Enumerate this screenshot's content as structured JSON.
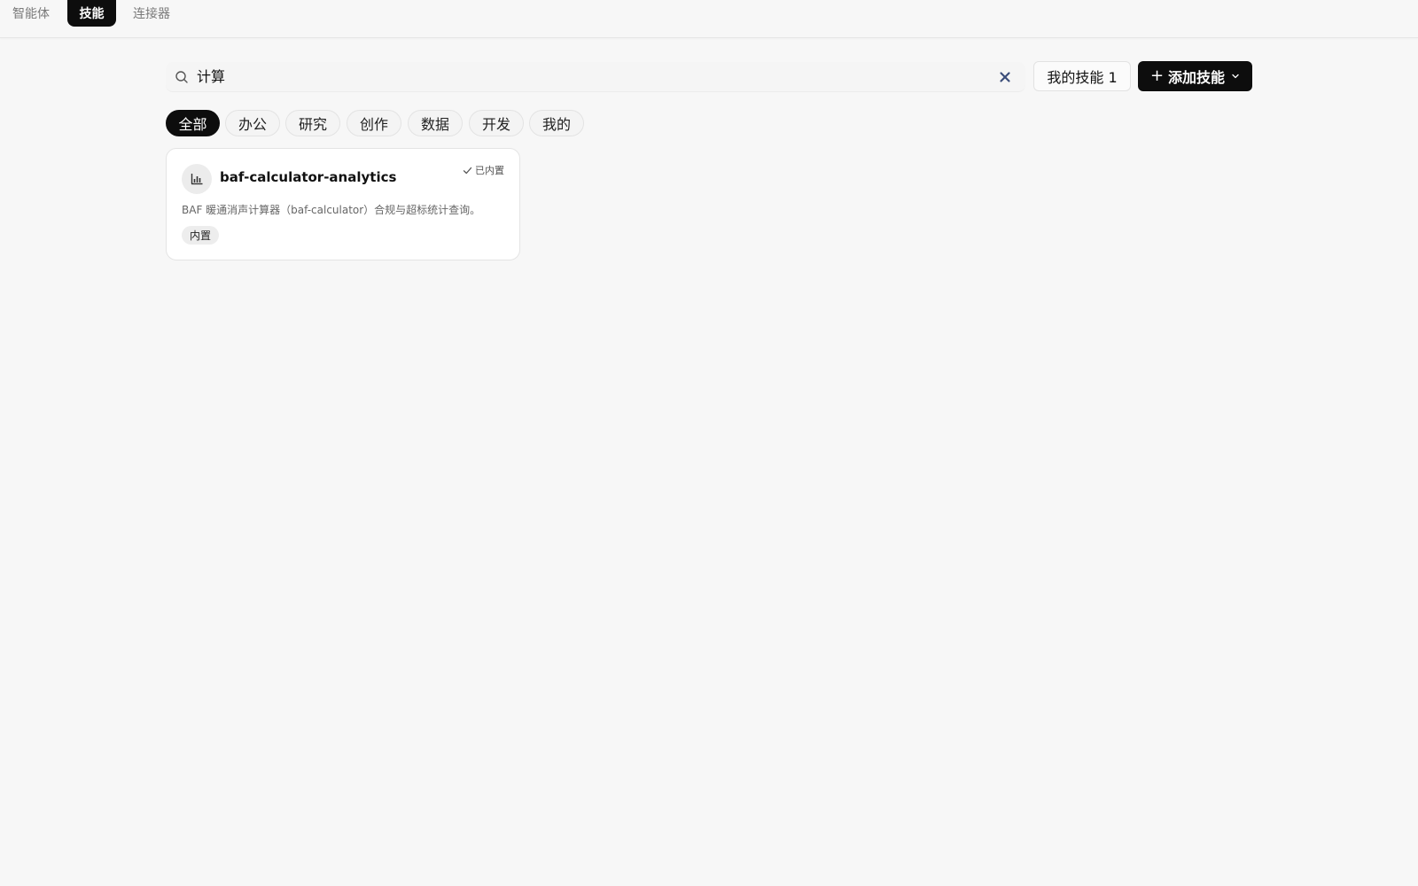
{
  "top_tabs": [
    {
      "label": "智能体",
      "active": false
    },
    {
      "label": "技能",
      "active": true
    },
    {
      "label": "连接器",
      "active": false
    }
  ],
  "search": {
    "value": "计算",
    "icon": "search-icon",
    "clear_icon": "close-icon"
  },
  "toolbar": {
    "my_skills_label": "我的技能 1",
    "add_skill_label": "添加技能",
    "add_skill_icon": "plus-icon"
  },
  "categories": [
    {
      "label": "全部",
      "active": true
    },
    {
      "label": "办公",
      "active": false
    },
    {
      "label": "研究",
      "active": false
    },
    {
      "label": "创作",
      "active": false
    },
    {
      "label": "数据",
      "active": false
    },
    {
      "label": "开发",
      "active": false
    },
    {
      "label": "我的",
      "active": false
    }
  ],
  "results": [
    {
      "icon": "bar-chart-icon",
      "title": "baf-calculator-analytics",
      "status": "已内置",
      "description": "BAF 暖通消声计算器（baf-calculator）合规与超标统计查询。",
      "badge": "内置"
    }
  ],
  "colors": {
    "background": "#f7f7f7",
    "accent": "#0d0d0d",
    "clear_icon": "#3b4e7a"
  }
}
